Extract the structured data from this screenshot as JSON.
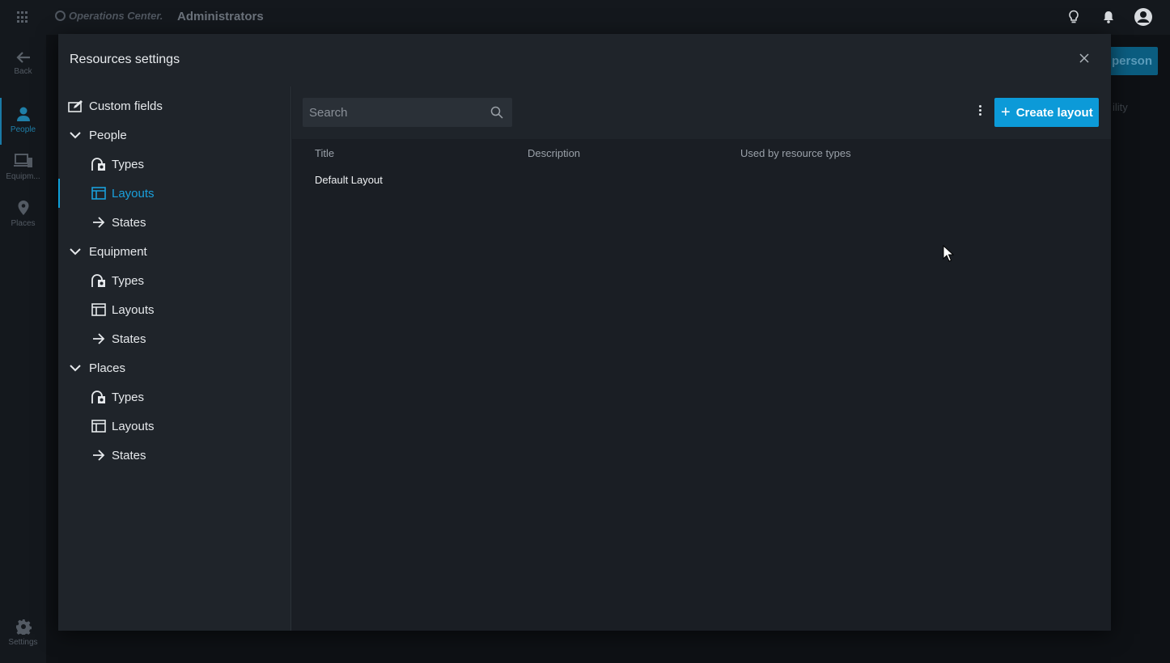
{
  "topbar": {
    "brand": "Operations Center.",
    "title": "Administrators"
  },
  "leftnav": {
    "back": "Back",
    "people": "People",
    "equipment": "Equipm...",
    "places": "Places",
    "settings": "Settings"
  },
  "background": {
    "person_button": "person",
    "fragment": "ility"
  },
  "modal": {
    "title": "Resources settings",
    "tree": {
      "custom_fields": "Custom fields",
      "people": {
        "label": "People",
        "types": "Types",
        "layouts": "Layouts",
        "states": "States"
      },
      "equipment": {
        "label": "Equipment",
        "types": "Types",
        "layouts": "Layouts",
        "states": "States"
      },
      "places": {
        "label": "Places",
        "types": "Types",
        "layouts": "Layouts",
        "states": "States"
      }
    },
    "search": {
      "placeholder": "Search",
      "value": ""
    },
    "create_button": "Create layout",
    "table": {
      "columns": [
        "Title",
        "Description",
        "Used by resource types"
      ],
      "rows": [
        {
          "title": "Default Layout",
          "description": "",
          "used_by": ""
        }
      ]
    }
  },
  "colors": {
    "accent": "#0c9ad8",
    "selected_text": "#1aa0dc",
    "modal_bg": "#1a1e24",
    "sidebar_bg": "#1f242a"
  }
}
